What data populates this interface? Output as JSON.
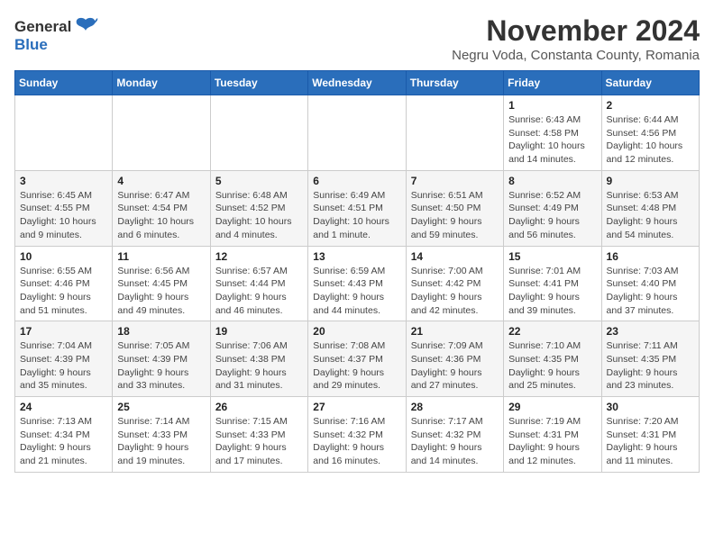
{
  "header": {
    "logo_general": "General",
    "logo_blue": "Blue",
    "title": "November 2024",
    "subtitle": "Negru Voda, Constanta County, Romania"
  },
  "calendar": {
    "days_of_week": [
      "Sunday",
      "Monday",
      "Tuesday",
      "Wednesday",
      "Thursday",
      "Friday",
      "Saturday"
    ],
    "weeks": [
      [
        {
          "day": "",
          "info": ""
        },
        {
          "day": "",
          "info": ""
        },
        {
          "day": "",
          "info": ""
        },
        {
          "day": "",
          "info": ""
        },
        {
          "day": "",
          "info": ""
        },
        {
          "day": "1",
          "info": "Sunrise: 6:43 AM\nSunset: 4:58 PM\nDaylight: 10 hours and 14 minutes."
        },
        {
          "day": "2",
          "info": "Sunrise: 6:44 AM\nSunset: 4:56 PM\nDaylight: 10 hours and 12 minutes."
        }
      ],
      [
        {
          "day": "3",
          "info": "Sunrise: 6:45 AM\nSunset: 4:55 PM\nDaylight: 10 hours and 9 minutes."
        },
        {
          "day": "4",
          "info": "Sunrise: 6:47 AM\nSunset: 4:54 PM\nDaylight: 10 hours and 6 minutes."
        },
        {
          "day": "5",
          "info": "Sunrise: 6:48 AM\nSunset: 4:52 PM\nDaylight: 10 hours and 4 minutes."
        },
        {
          "day": "6",
          "info": "Sunrise: 6:49 AM\nSunset: 4:51 PM\nDaylight: 10 hours and 1 minute."
        },
        {
          "day": "7",
          "info": "Sunrise: 6:51 AM\nSunset: 4:50 PM\nDaylight: 9 hours and 59 minutes."
        },
        {
          "day": "8",
          "info": "Sunrise: 6:52 AM\nSunset: 4:49 PM\nDaylight: 9 hours and 56 minutes."
        },
        {
          "day": "9",
          "info": "Sunrise: 6:53 AM\nSunset: 4:48 PM\nDaylight: 9 hours and 54 minutes."
        }
      ],
      [
        {
          "day": "10",
          "info": "Sunrise: 6:55 AM\nSunset: 4:46 PM\nDaylight: 9 hours and 51 minutes."
        },
        {
          "day": "11",
          "info": "Sunrise: 6:56 AM\nSunset: 4:45 PM\nDaylight: 9 hours and 49 minutes."
        },
        {
          "day": "12",
          "info": "Sunrise: 6:57 AM\nSunset: 4:44 PM\nDaylight: 9 hours and 46 minutes."
        },
        {
          "day": "13",
          "info": "Sunrise: 6:59 AM\nSunset: 4:43 PM\nDaylight: 9 hours and 44 minutes."
        },
        {
          "day": "14",
          "info": "Sunrise: 7:00 AM\nSunset: 4:42 PM\nDaylight: 9 hours and 42 minutes."
        },
        {
          "day": "15",
          "info": "Sunrise: 7:01 AM\nSunset: 4:41 PM\nDaylight: 9 hours and 39 minutes."
        },
        {
          "day": "16",
          "info": "Sunrise: 7:03 AM\nSunset: 4:40 PM\nDaylight: 9 hours and 37 minutes."
        }
      ],
      [
        {
          "day": "17",
          "info": "Sunrise: 7:04 AM\nSunset: 4:39 PM\nDaylight: 9 hours and 35 minutes."
        },
        {
          "day": "18",
          "info": "Sunrise: 7:05 AM\nSunset: 4:39 PM\nDaylight: 9 hours and 33 minutes."
        },
        {
          "day": "19",
          "info": "Sunrise: 7:06 AM\nSunset: 4:38 PM\nDaylight: 9 hours and 31 minutes."
        },
        {
          "day": "20",
          "info": "Sunrise: 7:08 AM\nSunset: 4:37 PM\nDaylight: 9 hours and 29 minutes."
        },
        {
          "day": "21",
          "info": "Sunrise: 7:09 AM\nSunset: 4:36 PM\nDaylight: 9 hours and 27 minutes."
        },
        {
          "day": "22",
          "info": "Sunrise: 7:10 AM\nSunset: 4:35 PM\nDaylight: 9 hours and 25 minutes."
        },
        {
          "day": "23",
          "info": "Sunrise: 7:11 AM\nSunset: 4:35 PM\nDaylight: 9 hours and 23 minutes."
        }
      ],
      [
        {
          "day": "24",
          "info": "Sunrise: 7:13 AM\nSunset: 4:34 PM\nDaylight: 9 hours and 21 minutes."
        },
        {
          "day": "25",
          "info": "Sunrise: 7:14 AM\nSunset: 4:33 PM\nDaylight: 9 hours and 19 minutes."
        },
        {
          "day": "26",
          "info": "Sunrise: 7:15 AM\nSunset: 4:33 PM\nDaylight: 9 hours and 17 minutes."
        },
        {
          "day": "27",
          "info": "Sunrise: 7:16 AM\nSunset: 4:32 PM\nDaylight: 9 hours and 16 minutes."
        },
        {
          "day": "28",
          "info": "Sunrise: 7:17 AM\nSunset: 4:32 PM\nDaylight: 9 hours and 14 minutes."
        },
        {
          "day": "29",
          "info": "Sunrise: 7:19 AM\nSunset: 4:31 PM\nDaylight: 9 hours and 12 minutes."
        },
        {
          "day": "30",
          "info": "Sunrise: 7:20 AM\nSunset: 4:31 PM\nDaylight: 9 hours and 11 minutes."
        }
      ]
    ]
  }
}
